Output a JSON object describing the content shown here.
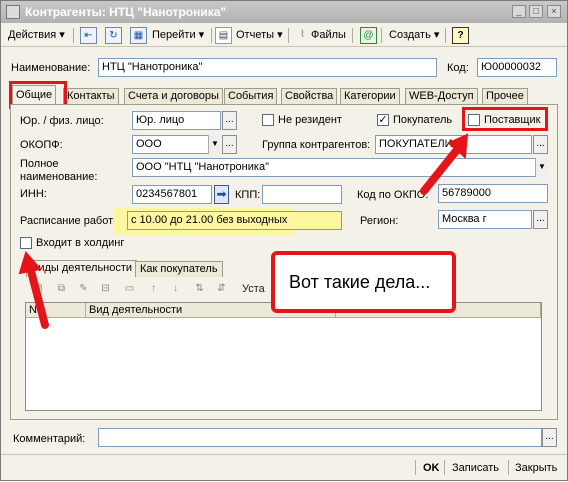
{
  "window": {
    "title": "Контрагенты: НТЦ \"Нанотроника\"",
    "min": "_",
    "max": "□",
    "close": "×"
  },
  "toolbar": {
    "actions": "Действия ▾",
    "goto": "Перейти ▾",
    "reports": "Отчеты ▾",
    "files": "Файлы",
    "create": "Создать ▾",
    "help": "?"
  },
  "header": {
    "name_label": "Наименование:",
    "name_value": "НТЦ \"Нанотроника\"",
    "code_label": "Код:",
    "code_value": "Ю00000032"
  },
  "tabs": [
    "Общие",
    "Контакты",
    "Счета и договоры",
    "События",
    "Свойства",
    "Категории",
    "WEB-Доступ",
    "Прочее"
  ],
  "general": {
    "legal_label": "Юр. / физ. лицо:",
    "legal_value": "Юр. лицо",
    "nonresident_label": "Не резидент",
    "buyer_label": "Покупатель",
    "supplier_label": "Поставщик",
    "okopf_label": "ОКОПФ:",
    "okopf_value": "ООО",
    "group_label": "Группа контрагентов:",
    "group_value": "ПОКУПАТЕЛИ",
    "fullname_label_1": "Полное",
    "fullname_label_2": "наименование:",
    "fullname_value": "ООО \"НТЦ \"Нанотроника\"",
    "inn_label": "ИНН:",
    "inn_value": "0234567801",
    "kpp_label": "КПП:",
    "kpp_value": "",
    "okpo_label": "Код по ОКПО:",
    "okpo_value": "56789000",
    "schedule_label": "Расписание работы:",
    "schedule_value": "с 10.00 до 21.00 без выходных",
    "region_label": "Регион:",
    "region_value": "Москва г",
    "holding_label": "Входит в холдинг"
  },
  "subtabs": [
    "Виды деятельности",
    "Как покупатель"
  ],
  "grid": {
    "toolbar_extra": "Уста",
    "col_n": "N",
    "col_activity": "Вид деятельности"
  },
  "callout": {
    "text": "Вот такие дела..."
  },
  "footer": {
    "comment_label": "Комментарий:",
    "comment_value": "",
    "ok": "OK",
    "save": "Записать",
    "close": "Закрыть"
  },
  "colors": {
    "highlight": "#fdf6a0",
    "annotation": "#e4151a"
  }
}
